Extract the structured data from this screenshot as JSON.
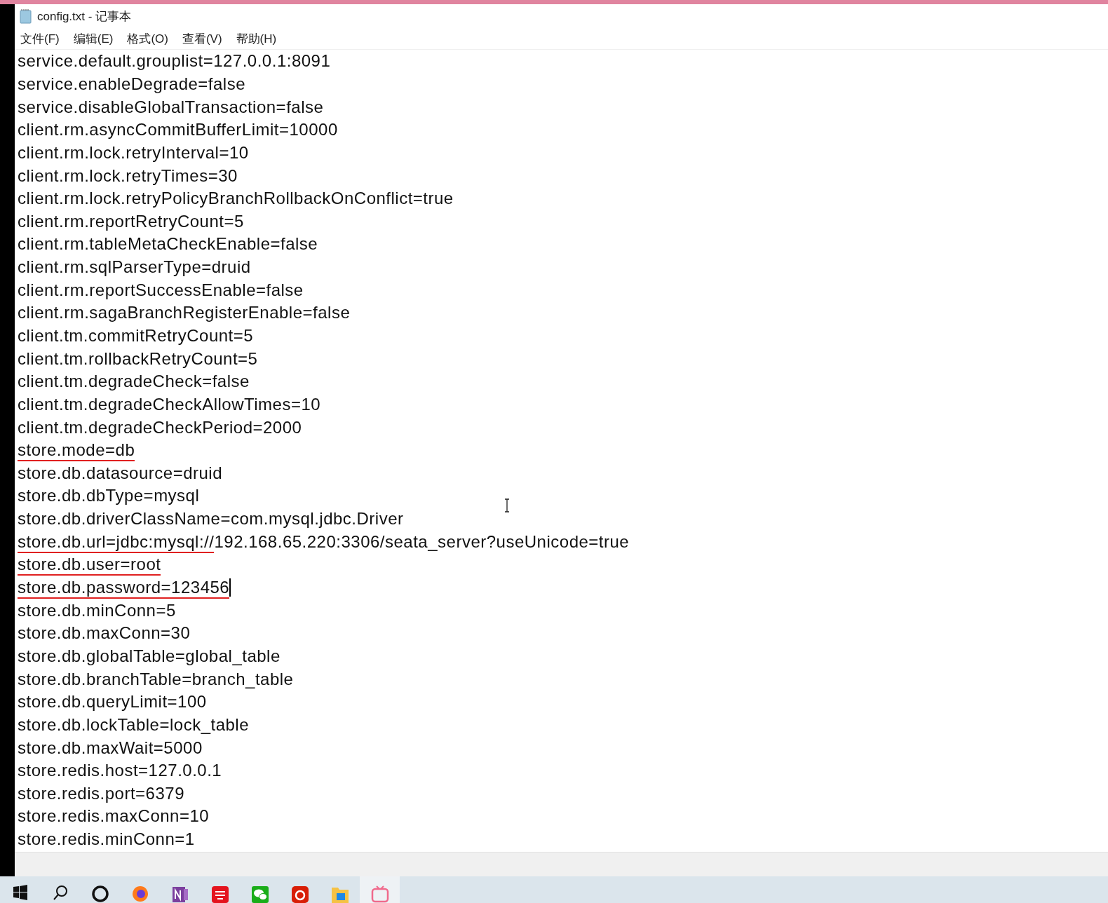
{
  "window": {
    "title": "config.txt - 记事本"
  },
  "menu": [
    "文件(F)",
    "编辑(E)",
    "格式(O)",
    "查看(V)",
    "帮助(H)"
  ],
  "lines": [
    {
      "text": "service.default.grouplist=127.0.0.1:8091"
    },
    {
      "text": "service.enableDegrade=false"
    },
    {
      "text": "service.disableGlobalTransaction=false"
    },
    {
      "text": "client.rm.asyncCommitBufferLimit=10000"
    },
    {
      "text": "client.rm.lock.retryInterval=10"
    },
    {
      "text": "client.rm.lock.retryTimes=30"
    },
    {
      "text": "client.rm.lock.retryPolicyBranchRollbackOnConflict=true"
    },
    {
      "text": "client.rm.reportRetryCount=5"
    },
    {
      "text": "client.rm.tableMetaCheckEnable=false"
    },
    {
      "text": "client.rm.sqlParserType=druid"
    },
    {
      "text": "client.rm.reportSuccessEnable=false"
    },
    {
      "text": "client.rm.sagaBranchRegisterEnable=false"
    },
    {
      "text": "client.tm.commitRetryCount=5"
    },
    {
      "text": "client.tm.rollbackRetryCount=5"
    },
    {
      "text": "client.tm.degradeCheck=false"
    },
    {
      "text": "client.tm.degradeCheckAllowTimes=10"
    },
    {
      "text": "client.tm.degradeCheckPeriod=2000"
    },
    {
      "annotated": "store.mode=db"
    },
    {
      "text": "store.db.datasource=druid"
    },
    {
      "text": "store.db.dbType=mysql"
    },
    {
      "text": "store.db.driverClassName=com.mysql.jdbc.Driver"
    },
    {
      "annotated": "store.db.url=jdbc:mysql://",
      "text": "192.168.65.220:3306/seata_server?useUnicode=true"
    },
    {
      "annotated": "store.db.user=root"
    },
    {
      "annotated": "store.db.password=123456",
      "caret": true
    },
    {
      "text": "store.db.minConn=5"
    },
    {
      "text": "store.db.maxConn=30"
    },
    {
      "text": "store.db.globalTable=global_table"
    },
    {
      "text": "store.db.branchTable=branch_table"
    },
    {
      "text": "store.db.queryLimit=100"
    },
    {
      "text": "store.db.lockTable=lock_table"
    },
    {
      "text": "store.db.maxWait=5000"
    },
    {
      "text": "store.redis.host=127.0.0.1"
    },
    {
      "text": "store.redis.port=6379"
    },
    {
      "text": "store.redis.maxConn=10"
    },
    {
      "text": "store.redis.minConn=1"
    }
  ],
  "taskbar": [
    {
      "kind": "start",
      "selected": false
    },
    {
      "kind": "search",
      "selected": false
    },
    {
      "kind": "ring",
      "selected": false
    },
    {
      "kind": "browser",
      "selected": false
    },
    {
      "kind": "notebook",
      "selected": false
    },
    {
      "kind": "dictionary",
      "selected": false
    },
    {
      "kind": "chat",
      "selected": false
    },
    {
      "kind": "music",
      "selected": false
    },
    {
      "kind": "folder",
      "selected": false
    },
    {
      "kind": "tv",
      "selected": true
    }
  ]
}
